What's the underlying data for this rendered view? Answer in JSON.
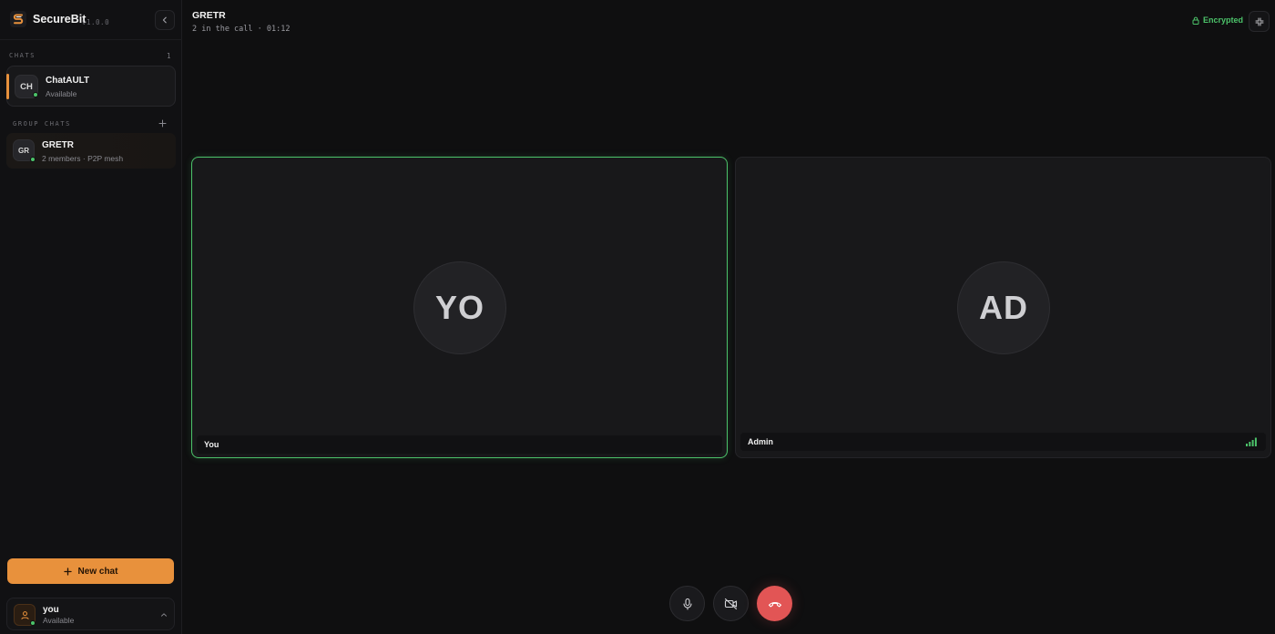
{
  "app": {
    "name": "SecureBit",
    "version": "v1.0.0"
  },
  "sidebar": {
    "chats_label": "CHATS",
    "chats_count": "1",
    "chats": [
      {
        "initials": "CH",
        "name": "ChatAULT",
        "status": "Available",
        "online": true,
        "active": true
      }
    ],
    "group_label": "GROUP CHATS",
    "groups": [
      {
        "initials": "GR",
        "name": "GRETR",
        "meta": "2 members · P2P mesh",
        "online": true
      }
    ],
    "new_chat_label": "New chat",
    "user": {
      "name": "you",
      "status": "Available",
      "online": true
    }
  },
  "call": {
    "title": "GRETR",
    "subtitle": "2 in the call · 01:12",
    "encrypted_label": "Encrypted",
    "participants": [
      {
        "initials": "YO",
        "name": "You",
        "speaking": true
      },
      {
        "initials": "AD",
        "name": "Admin",
        "signal_bars": 4
      }
    ]
  },
  "controls": {
    "mic": "mic-icon",
    "camera": "camera-off-icon",
    "end": "hang-up-icon"
  },
  "colors": {
    "accent": "#e8913c",
    "online": "#4cc36a",
    "danger": "#e25555",
    "background": "#0f0f10"
  }
}
